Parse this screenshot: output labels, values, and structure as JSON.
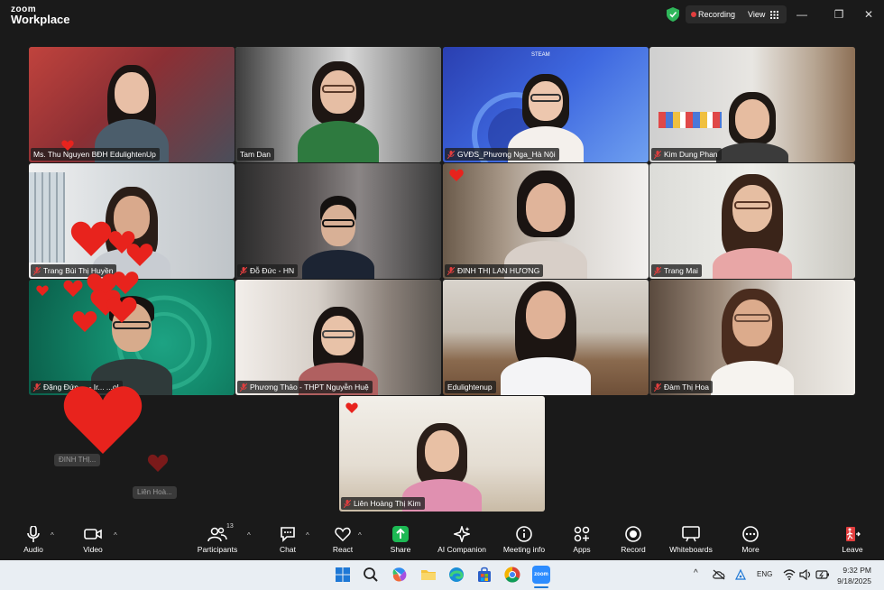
{
  "app": {
    "logo_top": "zoom",
    "logo_bottom": "Workplace"
  },
  "titlebar": {
    "recording_label": "Recording",
    "view_label": "View",
    "minimize_glyph": "—",
    "restore_glyph": "❐",
    "close_glyph": "✕"
  },
  "participants": [
    {
      "name": "Ms. Thu Nguyen BĐH EdulightenUp",
      "muted": false
    },
    {
      "name": "Tam Dan",
      "muted": false
    },
    {
      "name": "GVĐS_Phương Nga_Hà Nội",
      "muted": true
    },
    {
      "name": "Kim Dung Phan",
      "muted": true
    },
    {
      "name": "Trang Bùi Thị Huyền",
      "muted": true
    },
    {
      "name": "Đỗ Đức - HN",
      "muted": true
    },
    {
      "name": "ĐINH THỊ LAN HƯƠNG",
      "muted": true
    },
    {
      "name": "Trang Mai",
      "muted": true
    },
    {
      "name": "Đặng Đức ... - Ir... ...ol",
      "muted": true
    },
    {
      "name": "Phương Thảo - THPT Nguyễn Huệ",
      "muted": true
    },
    {
      "name": "Edulightenup",
      "muted": false
    },
    {
      "name": "Đàm Thị Hoa",
      "muted": true
    },
    {
      "name": "Liên Hoàng Thị Kim",
      "muted": true
    }
  ],
  "steam_logo_text": "STEAM",
  "floating_labels": [
    "ĐINH THỊ...",
    "Liên Hoà..."
  ],
  "toolbar": {
    "audio": "Audio",
    "video": "Video",
    "participants": "Participants",
    "participants_count": "13",
    "chat": "Chat",
    "react": "React",
    "share": "Share",
    "ai_companion": "AI Companion",
    "meeting_info": "Meeting info",
    "apps": "Apps",
    "record": "Record",
    "whiteboards": "Whiteboards",
    "more": "More",
    "leave": "Leave"
  },
  "taskbar": {
    "zoom_label": "zoom",
    "language": "ENG",
    "time": "9:32 PM",
    "date": "9/18/2025"
  },
  "colors": {
    "accent_green": "#3bd77a",
    "recording_red": "#e23e3e",
    "heart_red": "#e8231d",
    "share_green": "#1db954"
  }
}
